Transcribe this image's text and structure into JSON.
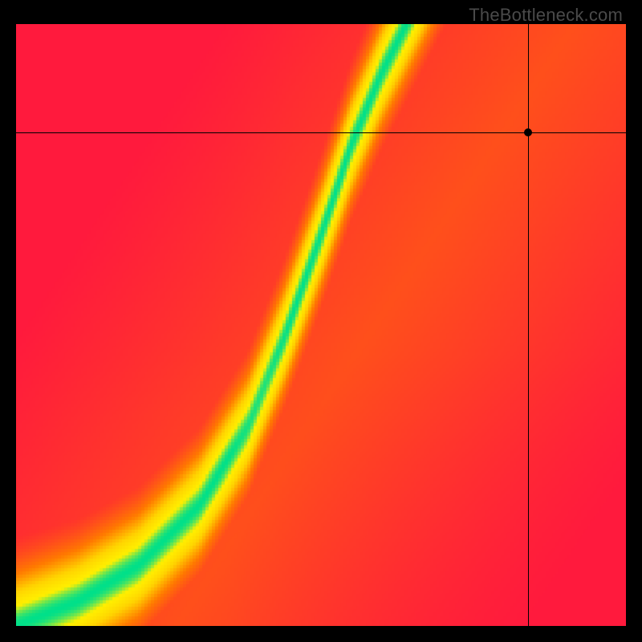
{
  "watermark": "TheBottleneck.com",
  "chart_data": {
    "type": "heatmap",
    "title": "",
    "xlabel": "",
    "ylabel": "",
    "xlim": [
      0,
      1
    ],
    "ylim": [
      0,
      1
    ],
    "grid": false,
    "color_scale": [
      "#ff1a3d",
      "#ff7a00",
      "#ffd400",
      "#fff000",
      "#00e08a"
    ],
    "optimal_curve": {
      "description": "narrow green band following a power/S curve from bottom-left to upper-center",
      "points": [
        {
          "x": 0.0,
          "y": 0.0
        },
        {
          "x": 0.1,
          "y": 0.04
        },
        {
          "x": 0.2,
          "y": 0.1
        },
        {
          "x": 0.3,
          "y": 0.2
        },
        {
          "x": 0.38,
          "y": 0.33
        },
        {
          "x": 0.44,
          "y": 0.48
        },
        {
          "x": 0.5,
          "y": 0.65
        },
        {
          "x": 0.55,
          "y": 0.8
        },
        {
          "x": 0.6,
          "y": 0.92
        },
        {
          "x": 0.64,
          "y": 1.0
        }
      ],
      "band_width": 0.06
    },
    "crosshair": {
      "x": 0.84,
      "y": 0.82
    },
    "marker": {
      "x": 0.84,
      "y": 0.82
    }
  }
}
